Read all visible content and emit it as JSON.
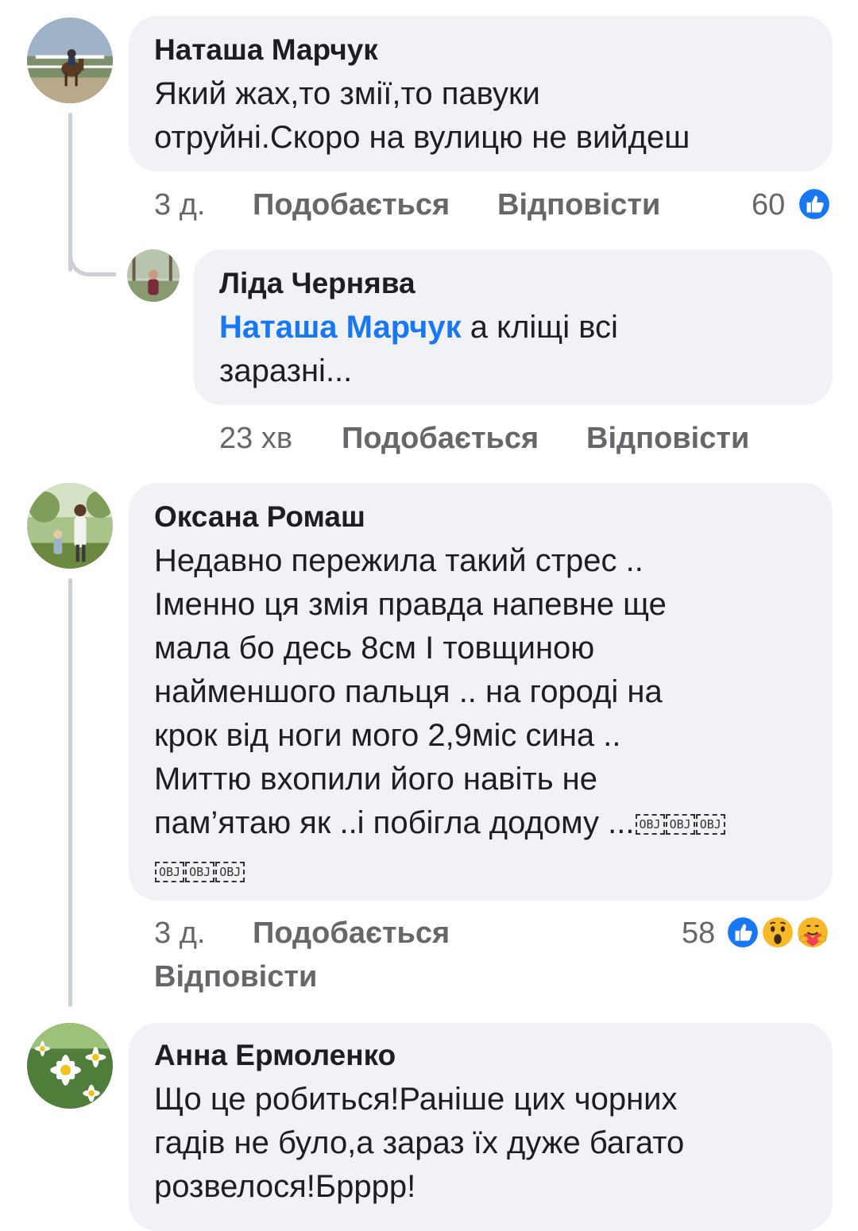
{
  "comments": [
    {
      "author": "Наташа Марчук",
      "lines": [
        "Який жах,то змії,то павуки",
        "отруйні.Скоро на вулицю не вийдеш"
      ],
      "time": "3 д.",
      "like_label": "Подобається",
      "reply_label": "Відповісти",
      "reaction_count": "60",
      "reactions": [
        "like-icon"
      ]
    },
    {
      "author": "Ліда Чернява",
      "mention": "Наташа Марчук",
      "line1_rest": " а кліщі всі",
      "line2": "заразні...",
      "time": "23 хв",
      "like_label": "Подобається",
      "reply_label": "Відповісти"
    },
    {
      "author": "Оксана Ромаш",
      "lines": [
        "Недавно пережила такий стрес ..",
        "Іменно ця змія правда напевне ще",
        "мала бо десь 8см І товщиною",
        "найменшого пальця .. на городі на",
        "крок від ноги  мого  2,9міс сина ..",
        "Миттю вхопили його навіть не",
        "пам’ятаю як ..і побігла додому ..."
      ],
      "obj_glyph": "OBJ",
      "time": "3 д.",
      "like_label": "Подобається",
      "reply_label": "Відповісти",
      "reaction_count": "58",
      "reactions": [
        "like-icon",
        "wow-icon",
        "care-icon"
      ]
    },
    {
      "author": "Анна Ермоленко",
      "lines": [
        "Що це робиться!Раніше цих чорних",
        "гадів не було,а зараз їх дуже багато",
        "розвелося!Брррр!"
      ]
    }
  ],
  "colors": {
    "bubble": "#f0f2f5",
    "mention": "#1877f2",
    "meta": "#65676b",
    "like_blue": "#1877f2"
  }
}
